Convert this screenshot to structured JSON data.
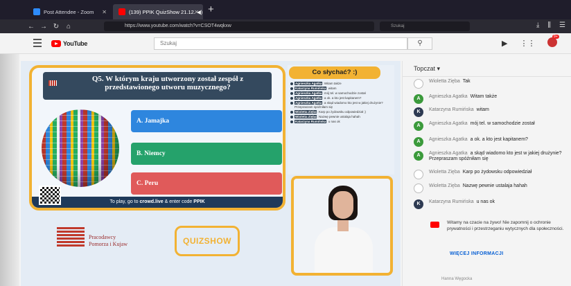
{
  "browser": {
    "tabs": [
      {
        "label": "Post Attendee - Zoom"
      },
      {
        "label": "(139) PPIK QuizShow 21.12. ◀)"
      }
    ],
    "url": "https://www.youtube.com/watch?v=CSOT4wqkxw",
    "url_search_placeholder": "Szukaj",
    "notification_count": "9+"
  },
  "youtube": {
    "logo": "YouTube",
    "search_placeholder": "Szukaj"
  },
  "quiz": {
    "question": "Q5. W którym kraju utworzony został zespół z przedstawionego utworu muzycznego?",
    "answers": [
      {
        "label": "A. Jamajka"
      },
      {
        "label": "B. Niemcy"
      },
      {
        "label": "C. Peru"
      }
    ],
    "join_prefix": "To play, go to ",
    "join_site": "crowd.live",
    "join_middle": " & enter code ",
    "join_code": "PPIK",
    "sponsor_line1": "Pracodawcy",
    "sponsor_line2": "Pomorza i Kujaw",
    "show_logo": "QUIZSHOW"
  },
  "video_chat": {
    "title": "Co słychać? :)",
    "lines": [
      {
        "author": "Agnieszka Agatka",
        "text": ": Witam także"
      },
      {
        "author": "Katarzyna Rumińska",
        "text": ": witam"
      },
      {
        "author": "Agnieszka Agatka",
        "text": ": mój tel. w samochodzie został"
      },
      {
        "author": "Agnieszka Agatka",
        "text": ": a ok. a kto jest kapitanem?"
      },
      {
        "author": "Agnieszka Agatka",
        "text": ": a skąd wiadomo kto jest w jakiej drużynie? Przepraszam spóźniłam się"
      },
      {
        "author": "Wioletta Zięba",
        "text": ": Karp po żydowsku odpowiedział ;)"
      },
      {
        "author": "Wioletta Zięba",
        "text": ": Nazwę pewnie ustalaja hahah"
      },
      {
        "author": "Katarzyna Rumińska",
        "text": ": u nas ok"
      }
    ]
  },
  "live_chat": {
    "header": "Topczat ▾",
    "messages": [
      {
        "initial": "",
        "author": "Wioletta Zięba",
        "text": "Tak",
        "avatar": "w"
      },
      {
        "initial": "A",
        "author": "Agnieszka Agatka",
        "text": "Witam także",
        "avatar": "a"
      },
      {
        "initial": "K",
        "author": "Katarzyna Rumińska",
        "text": "witam",
        "avatar": "k"
      },
      {
        "initial": "A",
        "author": "Agnieszka Agatka",
        "text": "mój tel. w samochodzie został",
        "avatar": "a"
      },
      {
        "initial": "A",
        "author": "Agnieszka Agatka",
        "text": "a ok. a kto jest kapitanem?",
        "avatar": "a"
      },
      {
        "initial": "A",
        "author": "Agnieszka Agatka",
        "text": "a skąd wiadomo kto jest w jakiej drużynie? Przepraszam spóźniłam się",
        "avatar": "a"
      },
      {
        "initial": "",
        "author": "Wioletta Zięba",
        "text": "Karp po żydowsku odpowiedział",
        "avatar": "w"
      },
      {
        "initial": "",
        "author": "Wioletta Zięba",
        "text": "Nazwę pewnie ustalaja hahah",
        "avatar": "w"
      },
      {
        "initial": "K",
        "author": "Katarzyna Rumińska",
        "text": "u nas ok",
        "avatar": "k"
      }
    ],
    "notice": "Witamy na czacie na żywo! Nie zapomnij o ochronie prywatności i przestrzeganiu wytycznych dla społeczności.",
    "more_info": "WIĘCEJ INFORMACJI",
    "next_author": "Hanna Węgocka"
  }
}
